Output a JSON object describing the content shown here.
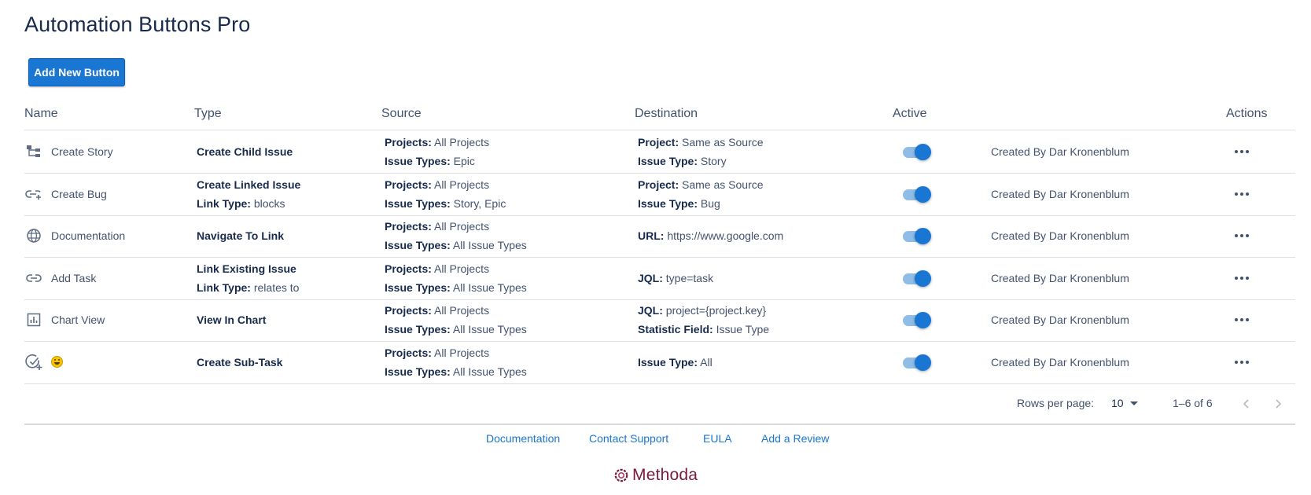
{
  "app": {
    "title": "Automation Buttons Pro",
    "add_button_label": "Add New Button"
  },
  "colors": {
    "primary": "#1976d2",
    "toggle_track": "#8fbde8",
    "text_dark": "#172b4d",
    "text_muted": "#42526e",
    "logo": "#7a1a3a"
  },
  "table": {
    "headers": {
      "name": "Name",
      "type": "Type",
      "source": "Source",
      "destination": "Destination",
      "active": "Active",
      "actions": "Actions"
    },
    "rows": [
      {
        "icon": "hierarchy-icon",
        "name": "Create Story",
        "type": "Create Child Issue",
        "type_sub_label": "",
        "type_sub_value": "",
        "src1_label": "Projects:",
        "src1_value": "All Projects",
        "src2_label": "Issue Types:",
        "src2_value": "Epic",
        "dst1_label": "Project:",
        "dst1_value": "Same as Source",
        "dst2_label": "Issue Type:",
        "dst2_value": "Story",
        "active": true,
        "created_by": "Created By Dar Kronenblum"
      },
      {
        "icon": "add-link-icon",
        "name": "Create Bug",
        "type": "Create Linked Issue",
        "type_sub_label": "Link Type:",
        "type_sub_value": "blocks",
        "src1_label": "Projects:",
        "src1_value": "All Projects",
        "src2_label": "Issue Types:",
        "src2_value": "Story, Epic",
        "dst1_label": "Project:",
        "dst1_value": "Same as Source",
        "dst2_label": "Issue Type:",
        "dst2_value": "Bug",
        "active": true,
        "created_by": "Created By Dar Kronenblum"
      },
      {
        "icon": "globe-icon",
        "name": "Documentation",
        "type": "Navigate To Link",
        "type_sub_label": "",
        "type_sub_value": "",
        "src1_label": "Projects:",
        "src1_value": "All Projects",
        "src2_label": "Issue Types:",
        "src2_value": "All Issue Types",
        "dst1_label": "URL:",
        "dst1_value": "https://www.google.com",
        "dst2_label": "",
        "dst2_value": "",
        "active": true,
        "created_by": "Created By Dar Kronenblum"
      },
      {
        "icon": "link-icon",
        "name": "Add Task",
        "type": "Link Existing Issue",
        "type_sub_label": "Link Type:",
        "type_sub_value": "relates to",
        "src1_label": "Projects:",
        "src1_value": "All Projects",
        "src2_label": "Issue Types:",
        "src2_value": "All Issue Types",
        "dst1_label": "JQL:",
        "dst1_value": "type=task",
        "dst2_label": "",
        "dst2_value": "",
        "active": true,
        "created_by": "Created By Dar Kronenblum"
      },
      {
        "icon": "bar-chart-icon",
        "name": "Chart View",
        "type": "View In Chart",
        "type_sub_label": "",
        "type_sub_value": "",
        "src1_label": "Projects:",
        "src1_value": "All Projects",
        "src2_label": "Issue Types:",
        "src2_value": "All Issue Types",
        "dst1_label": "JQL:",
        "dst1_value": "project={project.key}",
        "dst2_label": "Statistic Field:",
        "dst2_value": "Issue Type",
        "active": true,
        "created_by": "Created By Dar Kronenblum"
      },
      {
        "icon": "add-task-icon",
        "name": "",
        "emoji": "smiley-emoji-icon",
        "type": "Create Sub-Task",
        "type_sub_label": "",
        "type_sub_value": "",
        "src1_label": "Projects:",
        "src1_value": "All Projects",
        "src2_label": "Issue Types:",
        "src2_value": "All Issue Types",
        "dst1_label": "Issue Type:",
        "dst1_value": "All",
        "dst2_label": "",
        "dst2_value": "",
        "active": true,
        "created_by": "Created By Dar Kronenblum"
      }
    ]
  },
  "pagination": {
    "rows_per_page_label": "Rows per page:",
    "rows_per_page_value": "10",
    "range": "1–6 of 6"
  },
  "footer": {
    "links": [
      "Documentation",
      "Contact Support",
      "EULA",
      "Add a Review"
    ],
    "logo_text": "Methoda"
  }
}
